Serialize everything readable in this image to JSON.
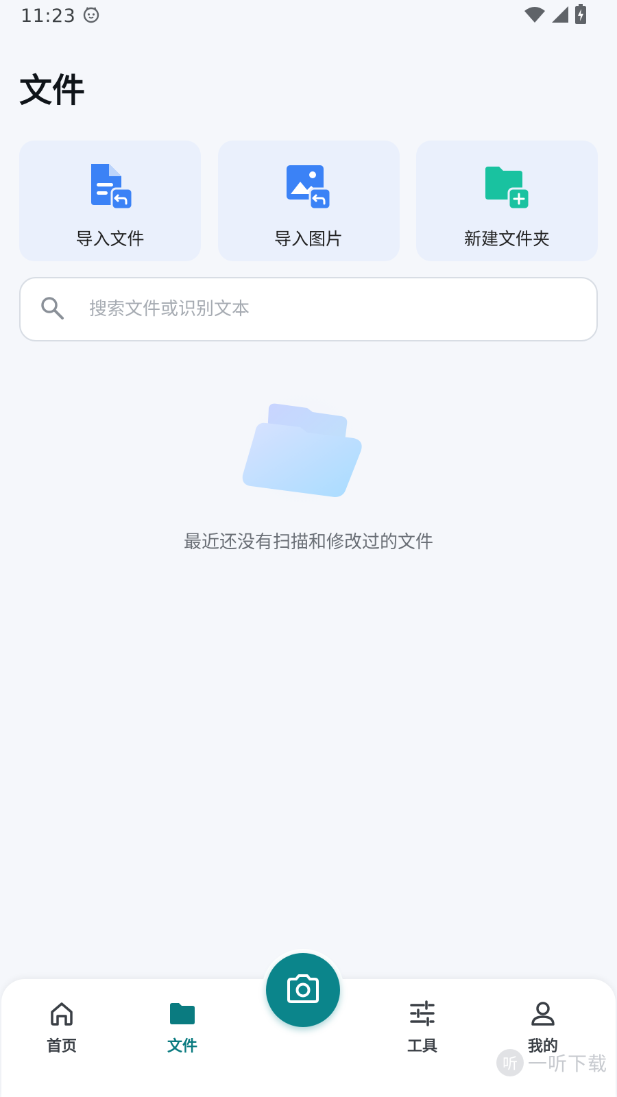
{
  "status_bar": {
    "time": "11:23",
    "icons": [
      "cat-face-icon",
      "wifi-icon",
      "signal-icon",
      "battery-charging-icon"
    ]
  },
  "page": {
    "title": "文件"
  },
  "actions": [
    {
      "label": "导入文件",
      "icon": "import-file-icon",
      "color": "#3b82f6"
    },
    {
      "label": "导入图片",
      "icon": "import-image-icon",
      "color": "#3b82f6"
    },
    {
      "label": "新建文件夹",
      "icon": "new-folder-icon",
      "color": "#19c2a0"
    }
  ],
  "search": {
    "placeholder": "搜索文件或识别文本",
    "value": ""
  },
  "empty_state": {
    "icon": "empty-folder-icon",
    "message": "最近还没有扫描和修改过的文件"
  },
  "bottom_nav": {
    "items": [
      {
        "label": "首页",
        "icon": "home-icon",
        "active": false
      },
      {
        "label": "文件",
        "icon": "folder-icon",
        "active": true
      },
      {
        "label": "工具",
        "icon": "sliders-icon",
        "active": false
      },
      {
        "label": "我的",
        "icon": "user-icon",
        "active": false
      }
    ],
    "center_button_icon": "camera-icon"
  },
  "watermark": {
    "badge": "听",
    "text": "一听下载"
  },
  "colors": {
    "accent": "#0b858b",
    "background": "#f5f7fb",
    "card": "#eaf0fc"
  }
}
